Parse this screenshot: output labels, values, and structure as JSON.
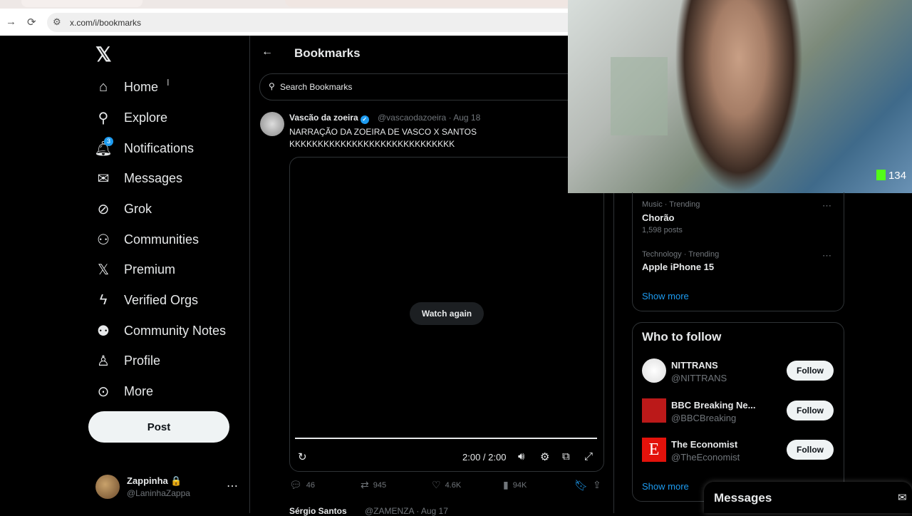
{
  "browser": {
    "url": "x.com/i/bookmarks",
    "back_icon": "→",
    "reload_icon": "⟳"
  },
  "nav": {
    "items": [
      {
        "label": "Home",
        "icon": "home-icon"
      },
      {
        "label": "Explore",
        "icon": "search-icon"
      },
      {
        "label": "Notifications",
        "icon": "bell-icon"
      },
      {
        "label": "Messages",
        "icon": "mail-icon"
      },
      {
        "label": "Grok",
        "icon": "grok-icon"
      },
      {
        "label": "Communities",
        "icon": "people-icon"
      },
      {
        "label": "Premium",
        "icon": "x-icon"
      },
      {
        "label": "Verified Orgs",
        "icon": "lightning-icon"
      },
      {
        "label": "Community Notes",
        "icon": "notes-icon"
      },
      {
        "label": "Profile",
        "icon": "person-icon"
      },
      {
        "label": "More",
        "icon": "more-circle-icon"
      }
    ],
    "notifications_badge": "3",
    "post_label": "Post"
  },
  "account": {
    "name": "Zappinha 🔒",
    "handle": "@LaninhaZappa"
  },
  "bookmarks": {
    "title": "Bookmarks",
    "search_placeholder": "Search Bookmarks",
    "tweet": {
      "author": "Vascão da zoeira",
      "meta": "@vascaodazoeira · Aug 18",
      "text_line1": "NARRAÇÃO DA ZOEIRA DE VASCO X SANTOS",
      "text_line2": "KKKKKKKKKKKKKKKKKKKKKKKKKKKKK",
      "watch_again": "Watch again",
      "time": "2:00 / 2:00",
      "replies": "46",
      "reposts": "945",
      "likes": "4.6K",
      "views": "94K"
    },
    "next_tweet": {
      "author": "Sérgio Santos",
      "meta": "@ZAMENZA · Aug 17"
    }
  },
  "trends": [
    {
      "category": "Music · Trending",
      "title": "Chorão",
      "posts": "1,598 posts"
    },
    {
      "category": "Technology · Trending",
      "title": "Apple iPhone 15",
      "posts": ""
    }
  ],
  "trends_show_more": "Show more",
  "who_to_follow": {
    "title": "Who to follow",
    "accounts": [
      {
        "name": "NITTRANS",
        "handle": "@NITTRANS"
      },
      {
        "name": "BBC Breaking Ne...",
        "handle": "@BBCBreaking"
      },
      {
        "name": "The Economist",
        "handle": "@TheEconomist"
      }
    ],
    "follow_label": "Follow",
    "show_more": "Show more"
  },
  "messages_drawer": {
    "title": "Messages"
  },
  "stream": {
    "viewer_count": "134"
  },
  "colors": {
    "accent": "#1d9bf0",
    "background": "#000000",
    "text": "#e7e9ea",
    "muted": "#71767b",
    "kick_green": "#53fc18"
  }
}
